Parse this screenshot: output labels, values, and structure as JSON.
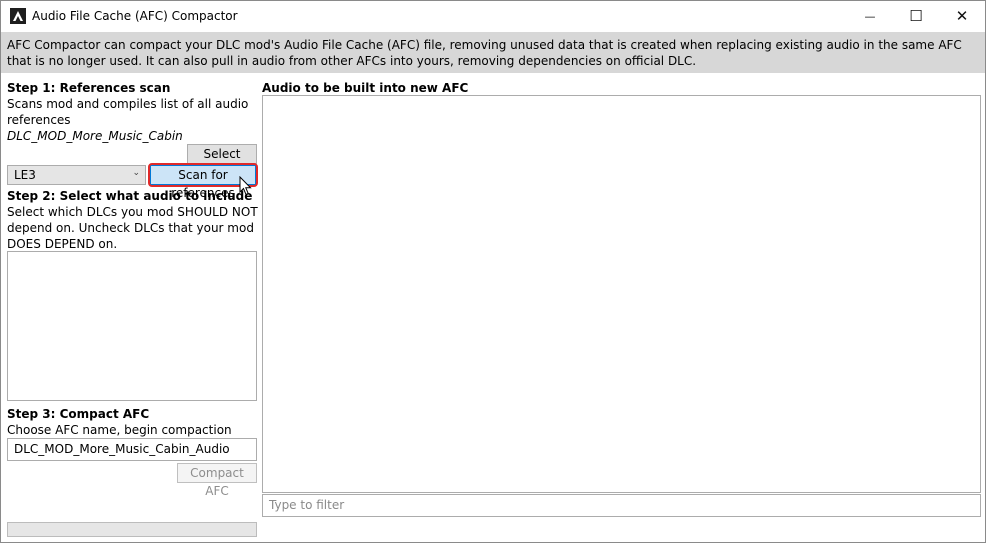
{
  "window": {
    "title": "Audio File Cache (AFC) Compactor",
    "minimize_glyph": "—",
    "maximize_glyph": "☐",
    "close_glyph": "✕"
  },
  "description": "AFC Compactor can compact your DLC mod's Audio File Cache (AFC) file, removing unused data that is created when replacing existing audio in the same AFC that is no longer used. It can also pull in audio from other AFCs into yours, removing dependencies on official DLC.",
  "step1": {
    "heading": "Step 1: References scan",
    "desc_line1": "Scans mod and compiles list of all audio",
    "desc_line2": "references",
    "selected_folder": "DLC_MOD_More_Music_Cabin",
    "select_folder_label": "Select folder",
    "game_selected": "LE3",
    "scan_label": "Scan for references"
  },
  "step2": {
    "heading": "Step 2: Select what audio to include",
    "desc_line1": "Select which DLCs you mod SHOULD NOT",
    "desc_line2": "depend on. Uncheck DLCs that your mod",
    "desc_line3": "DOES DEPEND on."
  },
  "step3": {
    "heading": "Step 3: Compact AFC",
    "desc": "Choose AFC name, begin compaction",
    "afc_name": "DLC_MOD_More_Music_Cabin_Audio",
    "compact_label": "Compact AFC"
  },
  "right": {
    "heading": "Audio to be built into new AFC",
    "filter_placeholder": "Type to filter"
  },
  "progress": {
    "value": 0
  },
  "colors": {
    "description_band": "#d7d7d7",
    "highlight": "#e02a2a",
    "focus_blue": "#cce4f7"
  },
  "icons": [
    "app-icon",
    "minimize-icon",
    "maximize-icon",
    "close-icon",
    "chevron-down-icon",
    "mouse-cursor-icon"
  ]
}
